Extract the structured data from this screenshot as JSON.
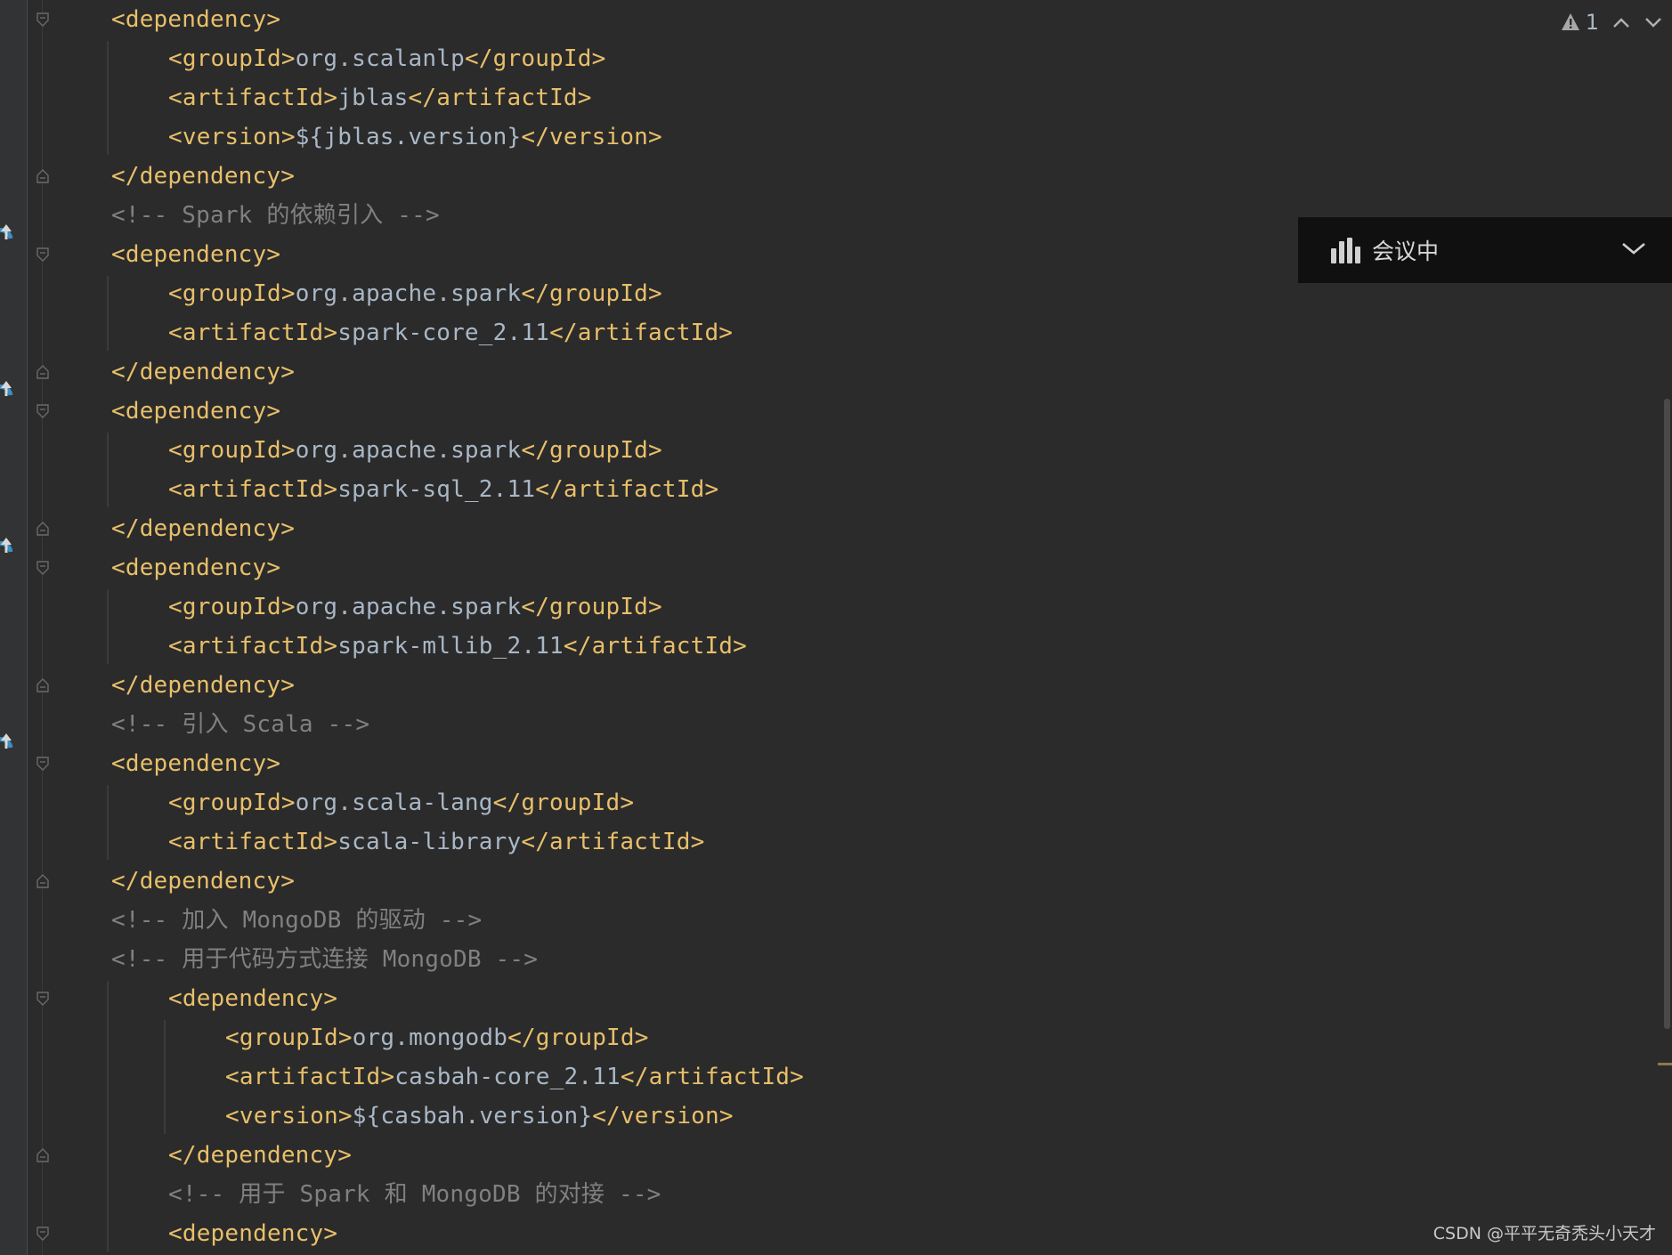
{
  "inspection": {
    "warning_count": "1"
  },
  "meeting": {
    "status": "会议中"
  },
  "watermark": "CSDN @平平无奇秃头小天才",
  "code": [
    {
      "parts": [
        [
          "tag",
          "<dependency>"
        ]
      ]
    },
    {
      "parts": [
        [
          "tag",
          "<groupId>"
        ],
        [
          "txt",
          "org.scalanlp"
        ],
        [
          "tag",
          "</groupId>"
        ]
      ]
    },
    {
      "parts": [
        [
          "tag",
          "<artifactId>"
        ],
        [
          "txt",
          "jblas"
        ],
        [
          "tag",
          "</artifactId>"
        ]
      ]
    },
    {
      "parts": [
        [
          "tag",
          "<version>"
        ],
        [
          "txt",
          "${jblas.version}"
        ],
        [
          "tag",
          "</version>"
        ]
      ]
    },
    {
      "parts": [
        [
          "tag",
          "</dependency>"
        ]
      ]
    },
    {
      "parts": [
        [
          "cmt",
          "<!-- Spark 的依赖引入 -->"
        ]
      ]
    },
    {
      "parts": [
        [
          "tag",
          "<dependency>"
        ]
      ]
    },
    {
      "parts": [
        [
          "tag",
          "<groupId>"
        ],
        [
          "txt",
          "org.apache.spark"
        ],
        [
          "tag",
          "</groupId>"
        ]
      ]
    },
    {
      "parts": [
        [
          "tag",
          "<artifactId>"
        ],
        [
          "txt",
          "spark-core_2.11"
        ],
        [
          "tag",
          "</artifactId>"
        ]
      ]
    },
    {
      "parts": [
        [
          "tag",
          "</dependency>"
        ]
      ]
    },
    {
      "parts": [
        [
          "tag",
          "<dependency>"
        ]
      ]
    },
    {
      "parts": [
        [
          "tag",
          "<groupId>"
        ],
        [
          "txt",
          "org.apache.spark"
        ],
        [
          "tag",
          "</groupId>"
        ]
      ]
    },
    {
      "parts": [
        [
          "tag",
          "<artifactId>"
        ],
        [
          "txt",
          "spark-sql_2.11"
        ],
        [
          "tag",
          "</artifactId>"
        ]
      ]
    },
    {
      "parts": [
        [
          "tag",
          "</dependency>"
        ]
      ]
    },
    {
      "parts": [
        [
          "tag",
          "<dependency>"
        ]
      ]
    },
    {
      "parts": [
        [
          "tag",
          "<groupId>"
        ],
        [
          "txt",
          "org.apache.spark"
        ],
        [
          "tag",
          "</groupId>"
        ]
      ]
    },
    {
      "parts": [
        [
          "tag",
          "<artifactId>"
        ],
        [
          "txt",
          "spark-mllib_2.11"
        ],
        [
          "tag",
          "</artifactId>"
        ]
      ]
    },
    {
      "parts": [
        [
          "tag",
          "</dependency>"
        ]
      ]
    },
    {
      "parts": [
        [
          "cmt",
          "<!-- 引入 Scala -->"
        ]
      ]
    },
    {
      "parts": [
        [
          "tag",
          "<dependency>"
        ]
      ]
    },
    {
      "parts": [
        [
          "tag",
          "<groupId>"
        ],
        [
          "txt",
          "org.scala-lang"
        ],
        [
          "tag",
          "</groupId>"
        ]
      ]
    },
    {
      "parts": [
        [
          "tag",
          "<artifactId>"
        ],
        [
          "txt",
          "scala-library"
        ],
        [
          "tag",
          "</artifactId>"
        ]
      ]
    },
    {
      "parts": [
        [
          "tag",
          "</dependency>"
        ]
      ]
    },
    {
      "parts": [
        [
          "cmt",
          "<!-- 加入 MongoDB 的驱动 -->"
        ]
      ]
    },
    {
      "parts": [
        [
          "cmt",
          "<!-- 用于代码方式连接 MongoDB -->"
        ]
      ]
    },
    {
      "parts": [
        [
          "tag",
          "<dependency>"
        ]
      ]
    },
    {
      "parts": [
        [
          "tag",
          "<groupId>"
        ],
        [
          "txt",
          "org.mongodb"
        ],
        [
          "tag",
          "</groupId>"
        ]
      ]
    },
    {
      "parts": [
        [
          "tag",
          "<artifactId>"
        ],
        [
          "txt",
          "casbah-core_2.11"
        ],
        [
          "tag",
          "</artifactId>"
        ]
      ]
    },
    {
      "parts": [
        [
          "tag",
          "<version>"
        ],
        [
          "txt",
          "${casbah.version}"
        ],
        [
          "tag",
          "</version>"
        ]
      ]
    },
    {
      "parts": [
        [
          "tag",
          "</dependency>"
        ]
      ]
    },
    {
      "parts": [
        [
          "cmt",
          "<!-- 用于 Spark 和 MongoDB 的对接 -->"
        ]
      ]
    },
    {
      "parts": [
        [
          "tag",
          "<dependency>"
        ]
      ]
    }
  ]
}
